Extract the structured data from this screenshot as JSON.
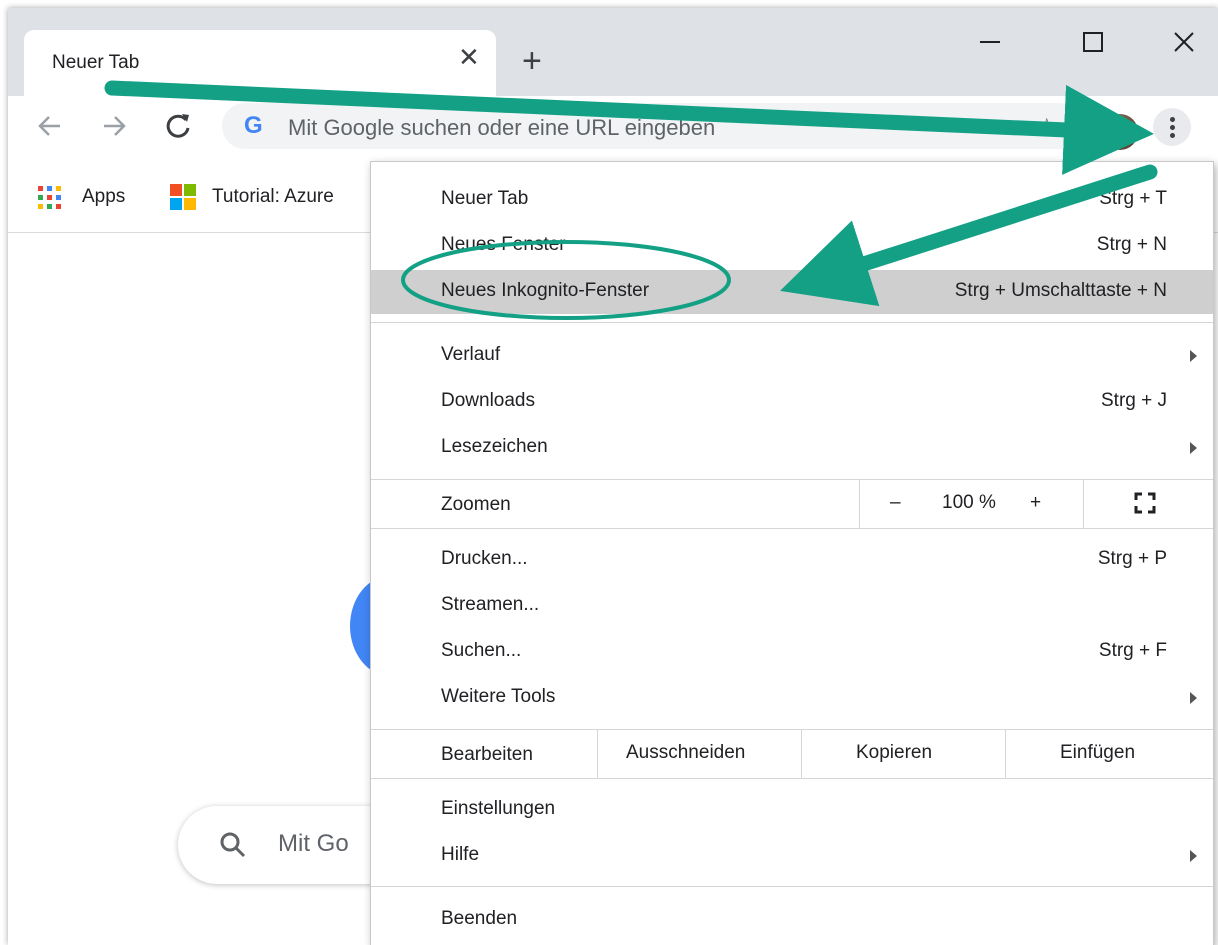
{
  "tab": {
    "title": "Neuer Tab",
    "close_icon": "close-icon",
    "new_tab_icon": "plus-icon"
  },
  "window": {
    "minimize_icon": "minimize-icon",
    "maximize_icon": "maximize-icon",
    "close_icon": "close-icon"
  },
  "toolbar": {
    "omnibox_placeholder": "Mit Google suchen oder eine URL eingeben",
    "google_logo": "G"
  },
  "bookmarks": [
    {
      "label": "Apps",
      "icon": "apps-grid-icon"
    },
    {
      "label": "Tutorial: Azure",
      "icon": "microsoft-logo-icon"
    }
  ],
  "page": {
    "search_placeholder": "Mit Go"
  },
  "menu": {
    "group1": [
      {
        "label": "Neuer Tab",
        "shortcut": "Strg + T"
      },
      {
        "label": "Neues Fenster",
        "shortcut": "Strg + N"
      },
      {
        "label": "Neues Inkognito-Fenster",
        "shortcut": "Strg + Umschalttaste + N",
        "highlighted": true
      }
    ],
    "group2": [
      {
        "label": "Verlauf",
        "submenu": true
      },
      {
        "label": "Downloads",
        "shortcut": "Strg + J"
      },
      {
        "label": "Lesezeichen",
        "submenu": true
      }
    ],
    "zoom": {
      "label": "Zoomen",
      "minus": "–",
      "value": "100 %",
      "plus": "+",
      "fullscreen_icon": "fullscreen-icon"
    },
    "group3": [
      {
        "label": "Drucken...",
        "shortcut": "Strg + P"
      },
      {
        "label": "Streamen..."
      },
      {
        "label": "Suchen...",
        "shortcut": "Strg + F"
      },
      {
        "label": "Weitere Tools",
        "submenu": true
      }
    ],
    "edit": {
      "label": "Bearbeiten",
      "cut": "Ausschneiden",
      "copy": "Kopieren",
      "paste": "Einfügen"
    },
    "group4": [
      {
        "label": "Einstellungen"
      },
      {
        "label": "Hilfe",
        "submenu": true
      }
    ],
    "exit": {
      "label": "Beenden"
    }
  },
  "colors": {
    "annotation": "#13a085",
    "accent": "#4285f4",
    "highlight": "#cfcfcf"
  }
}
